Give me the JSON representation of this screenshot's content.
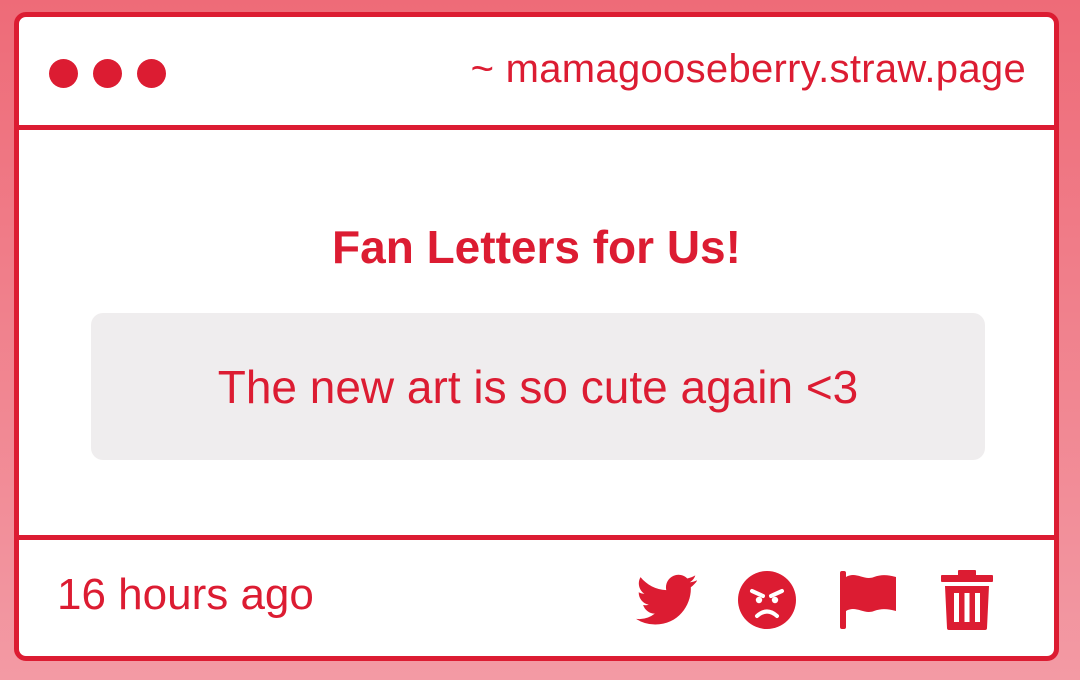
{
  "window": {
    "url": "~ mamagooseberry.straw.page"
  },
  "content": {
    "heading": "Fan Letters for Us!",
    "message": "The new art is so cute again <3"
  },
  "footer": {
    "timestamp": "16 hours ago",
    "actions": [
      {
        "icon": "twitter-icon"
      },
      {
        "icon": "angry-face-icon"
      },
      {
        "icon": "flag-icon"
      },
      {
        "icon": "trash-icon"
      }
    ]
  },
  "colors": {
    "accent": "#dc1c32",
    "background_top": "#ee6b78",
    "background_bottom": "#f39aa4",
    "message_box": "#efedee",
    "window": "#ffffff"
  }
}
